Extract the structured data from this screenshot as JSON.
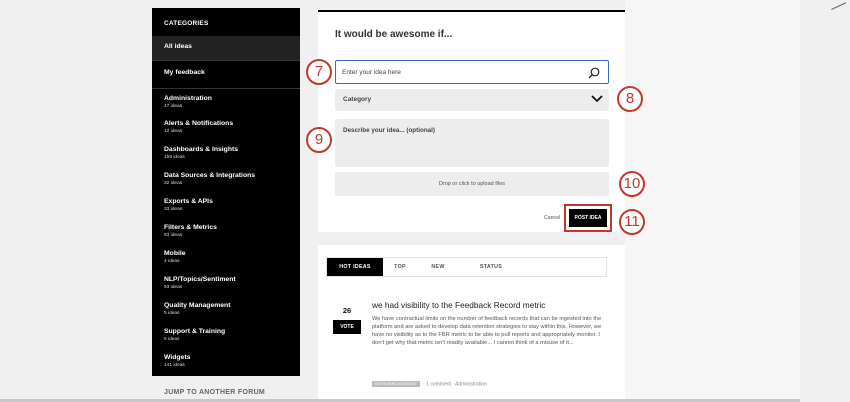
{
  "sidebar": {
    "title": "CATEGORIES",
    "items": [
      {
        "label": "All ideas",
        "count": ""
      },
      {
        "label": "My feedback",
        "count": ""
      },
      {
        "label": "Administration",
        "count": "47 ideas"
      },
      {
        "label": "Alerts & Notifications",
        "count": "12 ideas"
      },
      {
        "label": "Dashboards & Insights",
        "count": "159 ideas"
      },
      {
        "label": "Data Sources & Integrations",
        "count": "32 ideas"
      },
      {
        "label": "Exports & APIs",
        "count": "33 ideas"
      },
      {
        "label": "Filters & Metrics",
        "count": "63 ideas"
      },
      {
        "label": "Mobile",
        "count": "4 ideas"
      },
      {
        "label": "NLP/Topics/Sentiment",
        "count": "93 ideas"
      },
      {
        "label": "Quality Management",
        "count": "5 ideas"
      },
      {
        "label": "Support & Training",
        "count": "5 ideas"
      },
      {
        "label": "Widgets",
        "count": "141 ideas"
      }
    ],
    "jump_label": "JUMP TO ANOTHER FORUM"
  },
  "form": {
    "heading": "It would be awesome if...",
    "idea_placeholder": "Enter your idea here",
    "category_label": "Category",
    "description_placeholder": "Describe your idea... (optional)",
    "upload_label": "Drop or click to upload files",
    "cancel_label": "Cancel",
    "post_label": "POST IDEA"
  },
  "callouts": [
    "7",
    "8",
    "9",
    "10",
    "11"
  ],
  "tabs": [
    "HOT IDEAS",
    "TOP",
    "NEW",
    "STATUS"
  ],
  "idea": {
    "votes": "26",
    "vote_label": "VOTE",
    "title": "we had visibility to the Feedback Record metric",
    "description": "We have contractual limits on the number of feedback records that can be ingested into the platform and are asked to develop data retention strategies to stay within this. However, we have no visibility as to the FBR metric to be able to pull reports and appropriately monitor. I don't get why that metric isn't readily available... I cannot think of a misuse of it...",
    "status": "GATHERING INTEREST",
    "comments": "· 1 comment · Administration"
  },
  "colors": {
    "accent": "#c0392b",
    "input_border": "#3a6fb3",
    "sidebar_bg": "#000000"
  }
}
